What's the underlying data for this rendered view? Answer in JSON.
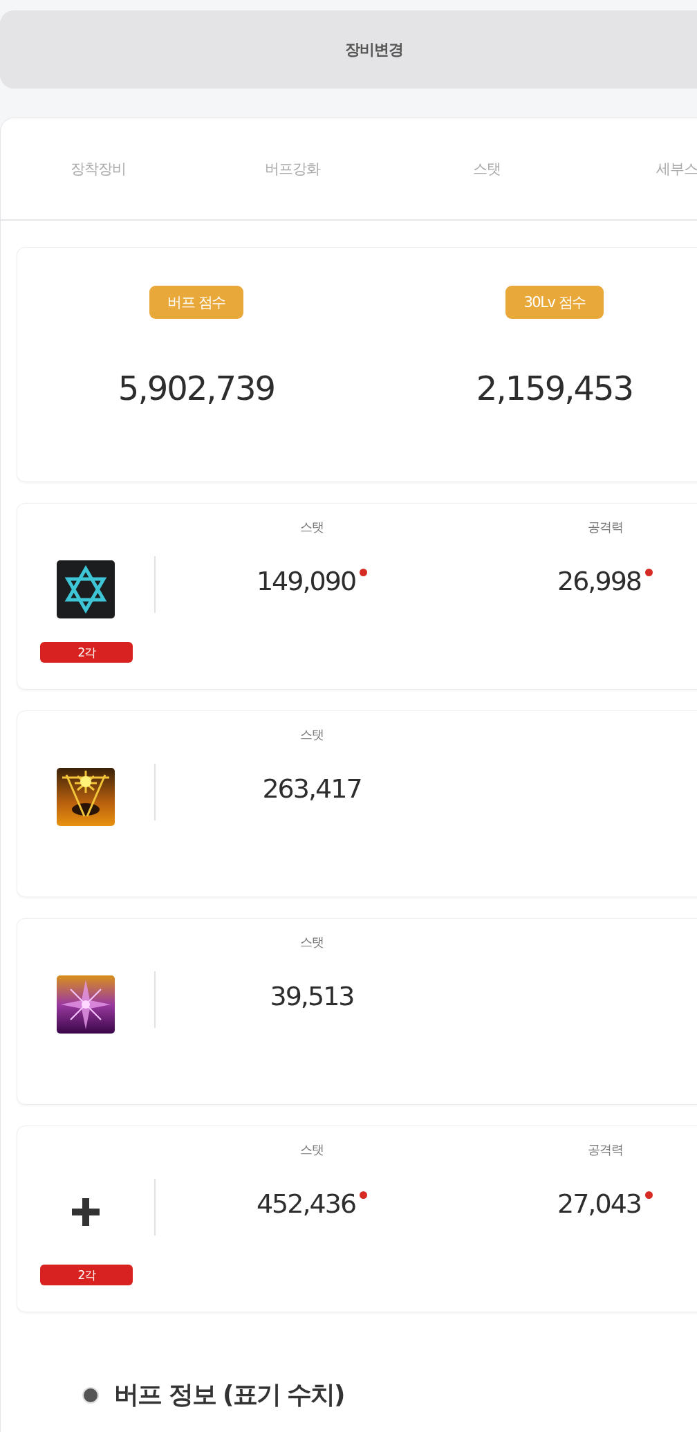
{
  "header": {
    "title": "장비변경"
  },
  "tabs": [
    {
      "label": "장착장비",
      "selected": false
    },
    {
      "label": "버프강화",
      "selected": false
    },
    {
      "label": "스탯",
      "selected": false
    },
    {
      "label": "세부스",
      "selected": false
    }
  ],
  "scores": [
    {
      "label": "버프 점수",
      "value": "5,902,739"
    },
    {
      "label": "30Lv 점수",
      "value": "2,159,453"
    }
  ],
  "buff_items": [
    {
      "kind": "hexagram",
      "grade": "2각",
      "stats": [
        {
          "label": "스탯",
          "value": "149,090",
          "marked": true
        },
        {
          "label": "공격력",
          "value": "26,998",
          "marked": true
        }
      ]
    },
    {
      "kind": "sunburst",
      "stats": [
        {
          "label": "스탯",
          "value": "263,417",
          "marked": false
        }
      ]
    },
    {
      "kind": "crystal",
      "stats": [
        {
          "label": "스탯",
          "value": "39,513",
          "marked": false
        }
      ]
    },
    {
      "kind": "plus",
      "grade": "2각",
      "stats": [
        {
          "label": "스탯",
          "value": "452,436",
          "marked": true
        },
        {
          "label": "공격력",
          "value": "27,043",
          "marked": true
        }
      ]
    }
  ],
  "section": {
    "title": "버프 정보 (표기 수치)"
  }
}
